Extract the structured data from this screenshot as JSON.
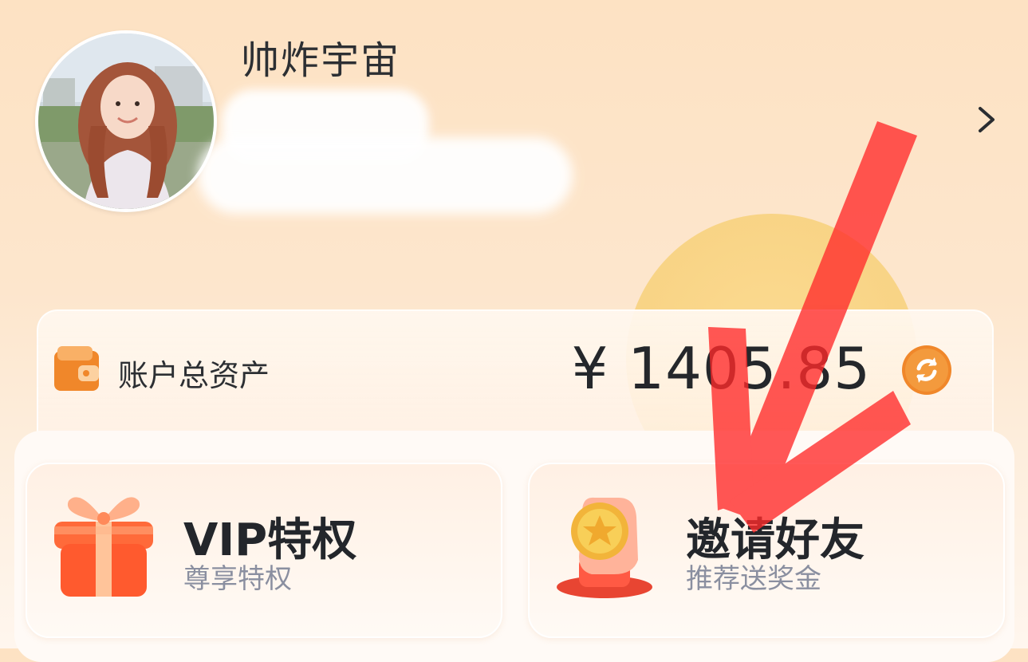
{
  "profile": {
    "username": "帅炸宇宙",
    "avatar_icon": "profile-photo"
  },
  "assets": {
    "label": "账户总资产",
    "amount": "¥ 1405.85"
  },
  "features": [
    {
      "title": "VIP特权",
      "subtitle": "尊享特权"
    },
    {
      "title": "邀请好友",
      "subtitle": "推荐送奖金"
    }
  ],
  "colors": {
    "accent_orange": "#f0872a",
    "annotation_red": "#ff2a2a",
    "sun": "#f8d27e"
  }
}
